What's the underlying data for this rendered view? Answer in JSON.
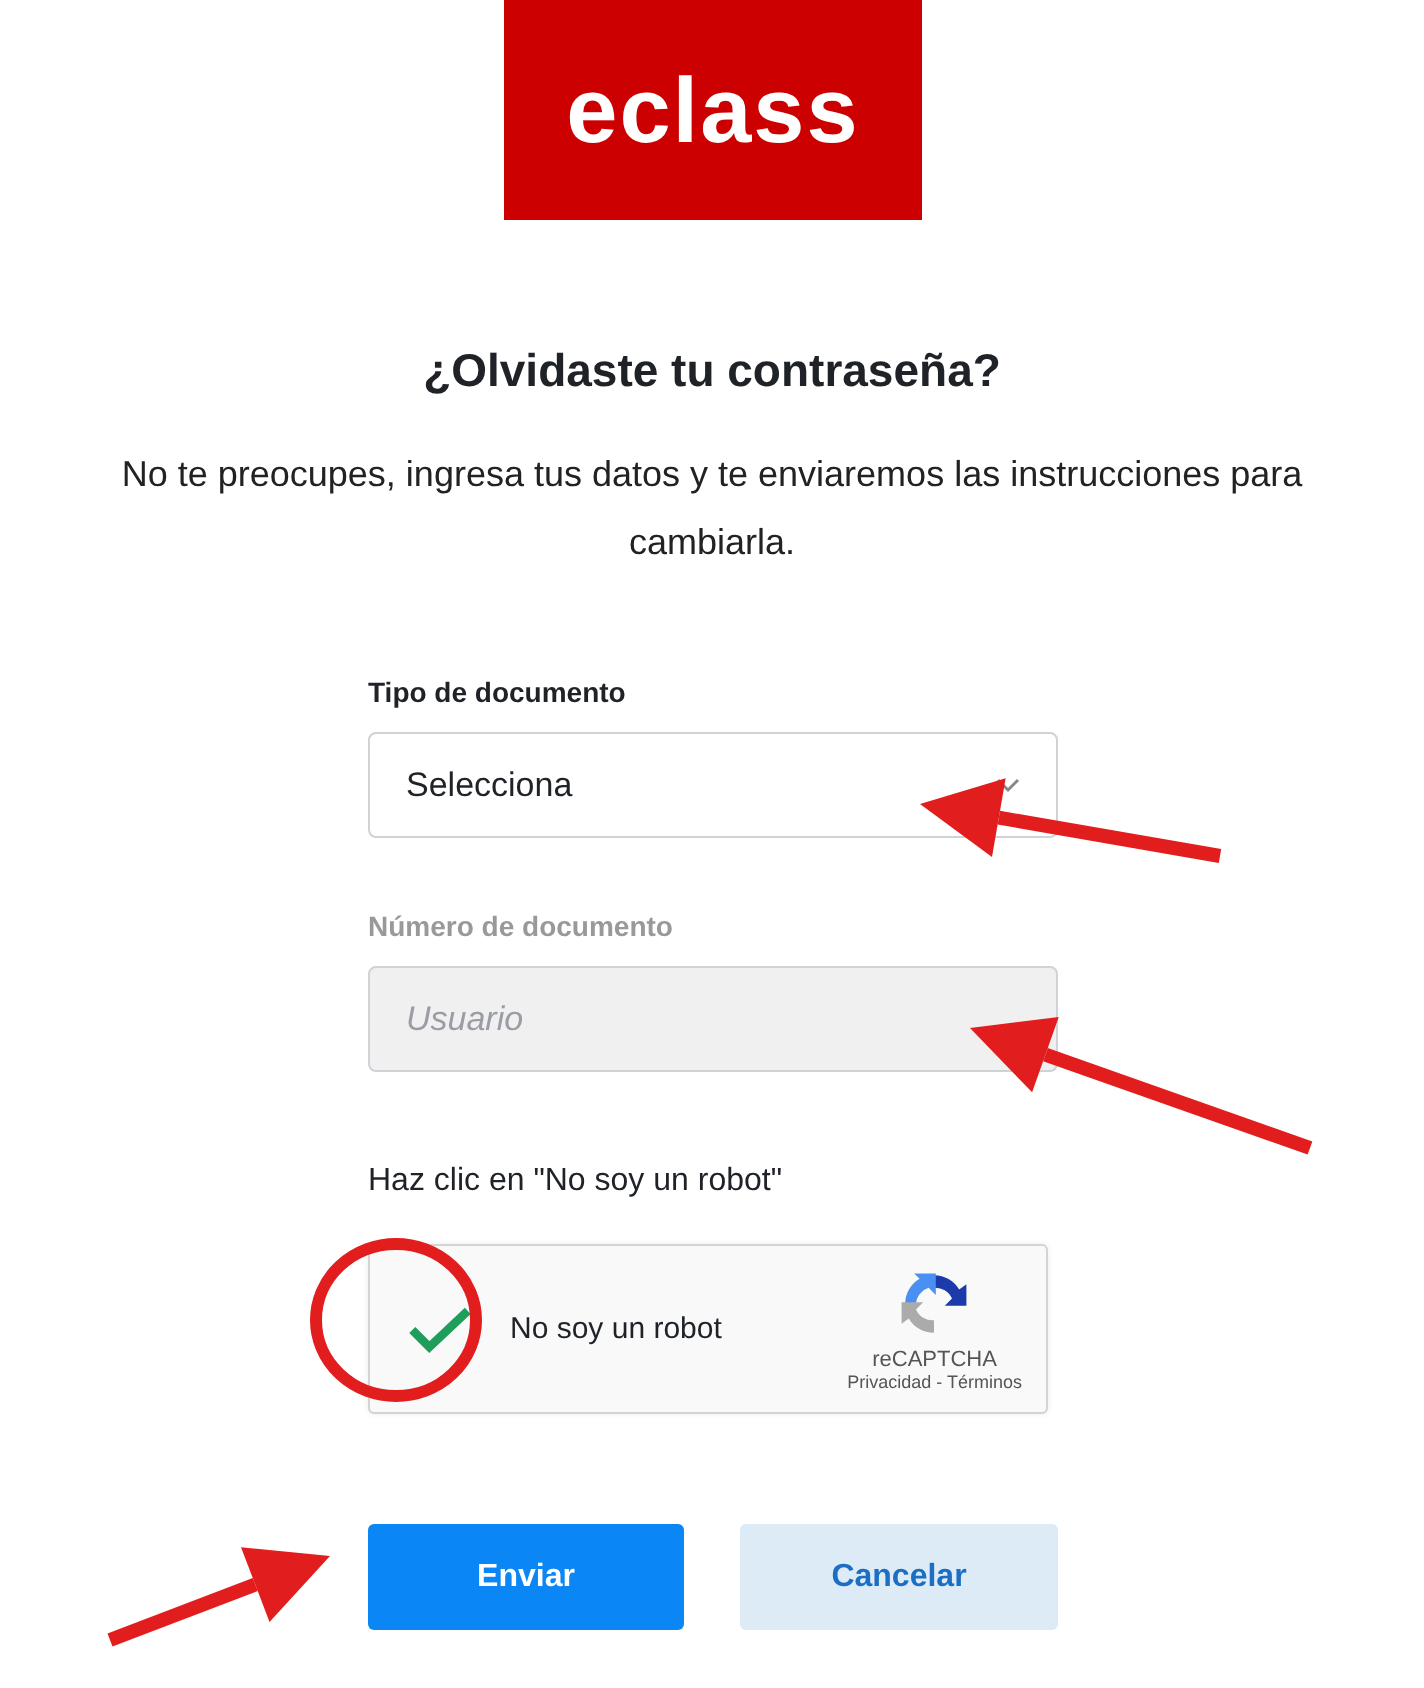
{
  "logo": {
    "text": "eclass"
  },
  "title": "¿Olvidaste tu contraseña?",
  "description": "No te preocupes, ingresa tus datos y te enviaremos las instrucciones para cambiarla.",
  "fields": [
    {
      "kind": "select",
      "label": "Tipo de documento",
      "value": "Selecciona",
      "disabled": false
    },
    {
      "kind": "text",
      "label": "Número de documento",
      "placeholder": "Usuario",
      "disabled": true
    }
  ],
  "captcha": {
    "prompt": "Haz clic en \"No soy un robot\"",
    "label": "No soy un robot",
    "checked": true,
    "brand": "reCAPTCHA",
    "privacy": "Privacidad",
    "separator": " - ",
    "terms": "Términos"
  },
  "buttons": [
    {
      "label": "Enviar",
      "kind": "primary"
    },
    {
      "label": "Cancelar",
      "kind": "secondary"
    }
  ],
  "annotations": [
    {
      "kind": "arrow"
    },
    {
      "kind": "arrow"
    },
    {
      "kind": "circle"
    },
    {
      "kind": "arrow"
    }
  ]
}
